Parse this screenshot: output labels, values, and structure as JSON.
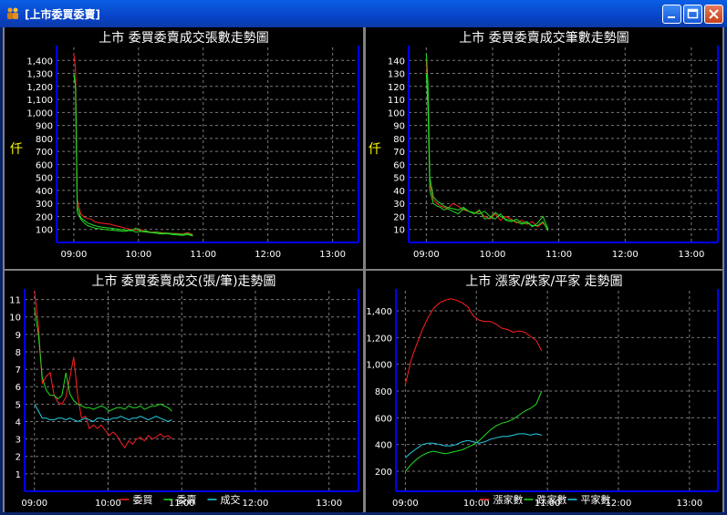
{
  "window": {
    "title": "[上市委買委賣]"
  },
  "colors": {
    "buy": "#ff2020",
    "sell": "#22dd22",
    "trade": "#22d0e8",
    "axis": "#0000ff",
    "grid": "#7a7a7a",
    "text": "#ffffff",
    "ylabel": "#ffff00"
  },
  "chart_data": [
    {
      "type": "line",
      "title": "上市 委買委賣成交張數走勢圖",
      "ylabel": "仟",
      "xlabel": "",
      "x_ticks": [
        "09:00",
        "10:00",
        "11:00",
        "12:00",
        "13:00"
      ],
      "y_ticks": [
        "100",
        "200",
        "300",
        "400",
        "500",
        "600",
        "700",
        "800",
        "900",
        "1,000",
        "1,100",
        "1,200",
        "1,300",
        "1,400"
      ],
      "ylim": [
        0,
        1500
      ],
      "xlim_minutes": [
        -10,
        165
      ],
      "grid": true,
      "x": [
        0,
        1,
        2,
        4,
        6,
        8,
        10,
        12,
        15,
        18,
        21,
        24,
        27,
        30,
        33,
        36,
        39,
        42,
        45,
        48,
        51,
        54,
        57,
        60,
        63,
        66,
        69
      ],
      "series": [
        {
          "color_key": "buy",
          "values": [
            1450,
            1340,
            330,
            220,
            195,
            185,
            180,
            160,
            150,
            145,
            140,
            130,
            120,
            110,
            100,
            95,
            95,
            85,
            80,
            80,
            75,
            72,
            70,
            68,
            65,
            75,
            60
          ]
        },
        {
          "color_key": "sell",
          "values": [
            1300,
            1200,
            280,
            190,
            170,
            150,
            140,
            130,
            120,
            115,
            110,
            105,
            100,
            95,
            90,
            110,
            85,
            80,
            75,
            80,
            70,
            72,
            68,
            65,
            62,
            70,
            55
          ]
        },
        {
          "color_key": "sell",
          "values": [
            1300,
            1200,
            230,
            180,
            150,
            130,
            120,
            110,
            105,
            100,
            95,
            92,
            88,
            85,
            95,
            80,
            85,
            90,
            75,
            70,
            65,
            68,
            60,
            58,
            55,
            60,
            50
          ]
        }
      ]
    },
    {
      "type": "line",
      "title": "上市 委買委賣成交筆數走勢圖",
      "ylabel": "仟",
      "xlabel": "",
      "x_ticks": [
        "09:00",
        "10:00",
        "11:00",
        "12:00",
        "13:00"
      ],
      "y_ticks": [
        "10",
        "20",
        "30",
        "40",
        "50",
        "60",
        "70",
        "80",
        "90",
        "100",
        "110",
        "120",
        "130",
        "140"
      ],
      "ylim": [
        0,
        150
      ],
      "xlim_minutes": [
        -10,
        165
      ],
      "grid": true,
      "x": [
        0,
        1,
        2,
        4,
        6,
        8,
        10,
        12,
        15,
        18,
        21,
        24,
        27,
        30,
        33,
        36,
        39,
        42,
        45,
        48,
        51,
        54,
        57,
        60,
        63,
        66,
        69
      ],
      "series": [
        {
          "color_key": "buy",
          "values": [
            140,
            110,
            45,
            33,
            30,
            28,
            27,
            26,
            30,
            28,
            25,
            24,
            22,
            24,
            20,
            18,
            22,
            17,
            20,
            18,
            15,
            17,
            14,
            16,
            12,
            15,
            10
          ]
        },
        {
          "color_key": "sell",
          "values": [
            145,
            120,
            50,
            35,
            32,
            30,
            28,
            27,
            26,
            25,
            27,
            24,
            23,
            22,
            24,
            20,
            18,
            22,
            17,
            16,
            18,
            15,
            16,
            12,
            15,
            20,
            10
          ]
        },
        {
          "color_key": "sell",
          "values": [
            130,
            100,
            40,
            30,
            28,
            27,
            25,
            26,
            24,
            22,
            26,
            24,
            22,
            25,
            18,
            19,
            23,
            20,
            18,
            17,
            16,
            14,
            15,
            13,
            13,
            16,
            9
          ]
        }
      ]
    },
    {
      "type": "line",
      "title": "上市 委買委賣成交(張/筆)走勢圖",
      "ylabel": "",
      "xlabel": "",
      "x_ticks": [
        "09:00",
        "10:00",
        "11:00",
        "12:00",
        "13:00"
      ],
      "y_ticks": [
        "1",
        "2",
        "3",
        "4",
        "5",
        "6",
        "7",
        "8",
        "9",
        "10",
        "11"
      ],
      "ylim": [
        0,
        11.5
      ],
      "xlim_minutes": [
        -5,
        165
      ],
      "grid": true,
      "legend": [
        "委買",
        "委賣",
        "成交"
      ],
      "x": [
        0,
        2,
        4,
        6,
        8,
        10,
        12,
        14,
        16,
        18,
        20,
        22,
        24,
        26,
        28,
        30,
        32,
        34,
        36,
        38,
        40,
        42,
        44,
        46,
        48,
        50,
        52,
        54,
        56,
        58,
        60,
        62,
        64,
        66,
        68,
        70
      ],
      "series": [
        {
          "name": "委買",
          "color_key": "buy",
          "values": [
            11.5,
            9.5,
            6.2,
            6.6,
            6.8,
            5.5,
            5.1,
            5.0,
            5.4,
            6.5,
            7.7,
            5.5,
            4.2,
            4.3,
            3.6,
            3.8,
            3.6,
            3.8,
            3.5,
            3.2,
            3.4,
            3.2,
            2.8,
            2.5,
            2.9,
            2.7,
            3.0,
            3.1,
            2.9,
            3.2,
            3.0,
            3.1,
            3.3,
            3.1,
            3.2,
            3.0
          ]
        },
        {
          "name": "委賣",
          "color_key": "sell",
          "values": [
            10.5,
            9.0,
            6.5,
            5.8,
            5.5,
            5.5,
            5.3,
            5.5,
            6.8,
            5.6,
            5.2,
            5.0,
            4.9,
            4.8,
            4.8,
            4.7,
            4.8,
            4.9,
            4.8,
            4.6,
            4.7,
            4.8,
            4.8,
            4.7,
            4.9,
            4.8,
            4.8,
            4.9,
            4.7,
            4.8,
            4.9,
            4.9,
            5.0,
            4.9,
            4.8,
            4.6
          ]
        },
        {
          "name": "成交",
          "color_key": "trade",
          "values": [
            5.0,
            4.6,
            4.2,
            4.2,
            4.1,
            4.1,
            4.2,
            4.2,
            4.1,
            4.2,
            4.1,
            4.0,
            4.1,
            4.2,
            4.1,
            4.0,
            4.2,
            4.2,
            4.1,
            4.1,
            4.2,
            4.2,
            4.3,
            4.2,
            4.1,
            4.2,
            4.2,
            4.3,
            4.2,
            4.1,
            4.2,
            4.3,
            4.2,
            4.1,
            4.0,
            4.1
          ]
        }
      ]
    },
    {
      "type": "line",
      "title": "上市 漲家/跌家/平家 走勢圖",
      "ylabel": "",
      "xlabel": "",
      "x_ticks": [
        "09:00",
        "10:00",
        "11:00",
        "12:00",
        "13:00"
      ],
      "y_ticks": [
        "200",
        "400",
        "600",
        "800",
        "1,000",
        "1,200",
        "1,400"
      ],
      "ylim": [
        50,
        1550
      ],
      "xlim_minutes": [
        -5,
        165
      ],
      "grid": true,
      "legend": [
        "漲家數",
        "跌家數",
        "平家數"
      ],
      "x": [
        0,
        3,
        6,
        9,
        12,
        15,
        18,
        21,
        24,
        27,
        30,
        33,
        36,
        39,
        42,
        45,
        48,
        51,
        54,
        57,
        60,
        63,
        66,
        69,
        72
      ],
      "series": [
        {
          "name": "漲家數",
          "color_key": "buy",
          "values": [
            850,
            1030,
            1150,
            1260,
            1350,
            1420,
            1460,
            1480,
            1490,
            1480,
            1460,
            1430,
            1360,
            1330,
            1320,
            1320,
            1300,
            1270,
            1260,
            1240,
            1250,
            1240,
            1210,
            1180,
            1100
          ]
        },
        {
          "name": "跌家數",
          "color_key": "sell",
          "values": [
            200,
            250,
            290,
            320,
            340,
            350,
            340,
            330,
            340,
            350,
            360,
            380,
            400,
            430,
            470,
            510,
            540,
            560,
            570,
            590,
            620,
            650,
            670,
            700,
            800
          ]
        },
        {
          "name": "平家數",
          "color_key": "trade",
          "values": [
            300,
            340,
            370,
            400,
            410,
            410,
            400,
            390,
            390,
            400,
            420,
            430,
            420,
            410,
            420,
            440,
            450,
            460,
            460,
            470,
            480,
            480,
            470,
            480,
            470
          ]
        }
      ]
    }
  ]
}
